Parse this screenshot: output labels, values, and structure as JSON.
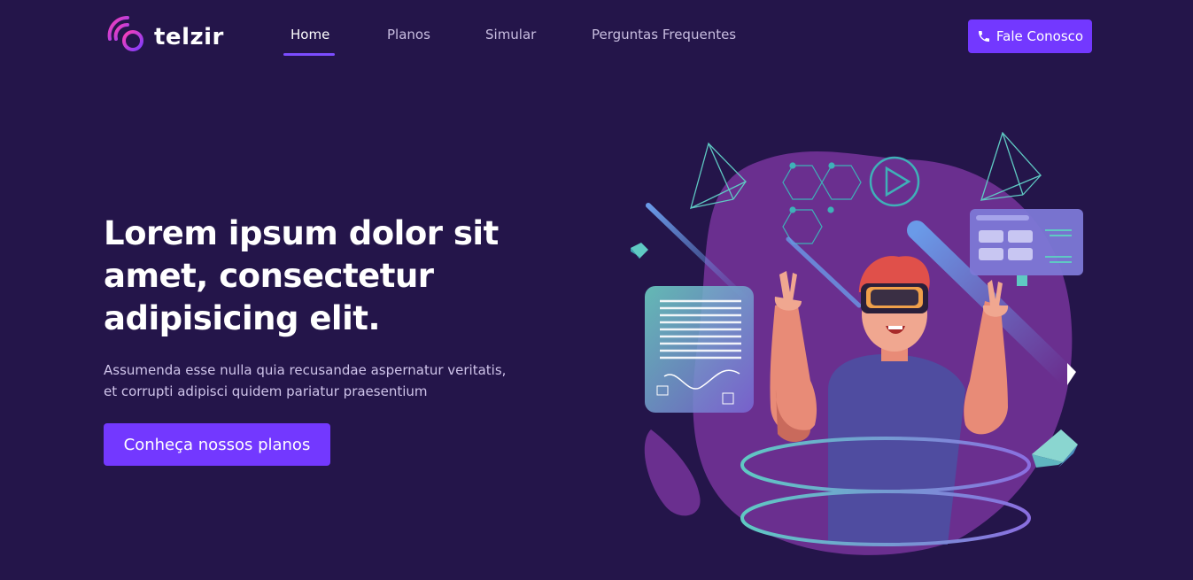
{
  "brand": {
    "name": "telzir",
    "logo_icon": "signal-p-logo"
  },
  "nav": {
    "items": [
      {
        "label": "Home",
        "active": true
      },
      {
        "label": "Planos",
        "active": false
      },
      {
        "label": "Simular",
        "active": false
      },
      {
        "label": "Perguntas Frequentes",
        "active": false
      }
    ],
    "contact_label": "Fale Conosco",
    "contact_icon": "phone-icon"
  },
  "hero": {
    "title": "Lorem ipsum dolor sit amet, consectetur adipisicing elit.",
    "subtitle": "Assumenda esse nulla quia recusandae aspernatur veritatis, et corrupti adipisci quidem pariatur praesentium",
    "cta_label": "Conheça nossos planos"
  },
  "colors": {
    "background": "#24154a",
    "accent": "#7338ff",
    "blob": "#6a2f8f",
    "teal": "#5fc9c3"
  }
}
